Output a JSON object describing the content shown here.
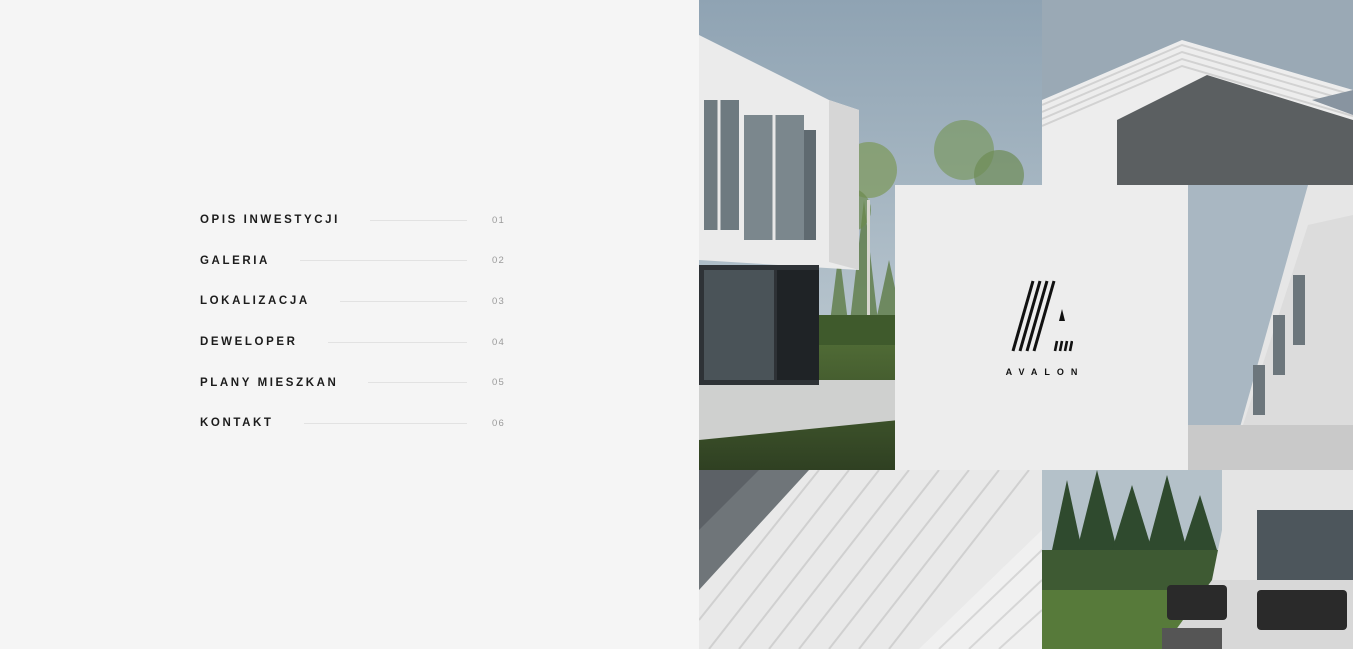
{
  "menu": {
    "items": [
      {
        "label": "OPIS INWESTYCJI",
        "number": "01"
      },
      {
        "label": "GALERIA",
        "number": "02"
      },
      {
        "label": "LOKALIZACJA",
        "number": "03"
      },
      {
        "label": "DEWELOPER",
        "number": "04"
      },
      {
        "label": "PLANY MIESZKAN",
        "number": "05"
      },
      {
        "label": "KONTAKT",
        "number": "06"
      }
    ]
  },
  "brand": {
    "logo_icon": "avalon-striped-a-icon",
    "name": "AVALON"
  },
  "gallery": {
    "tiles": [
      "house-corner-photo",
      "facade-detail-photo",
      "wall-texture-photo",
      "terrace-photo"
    ]
  }
}
